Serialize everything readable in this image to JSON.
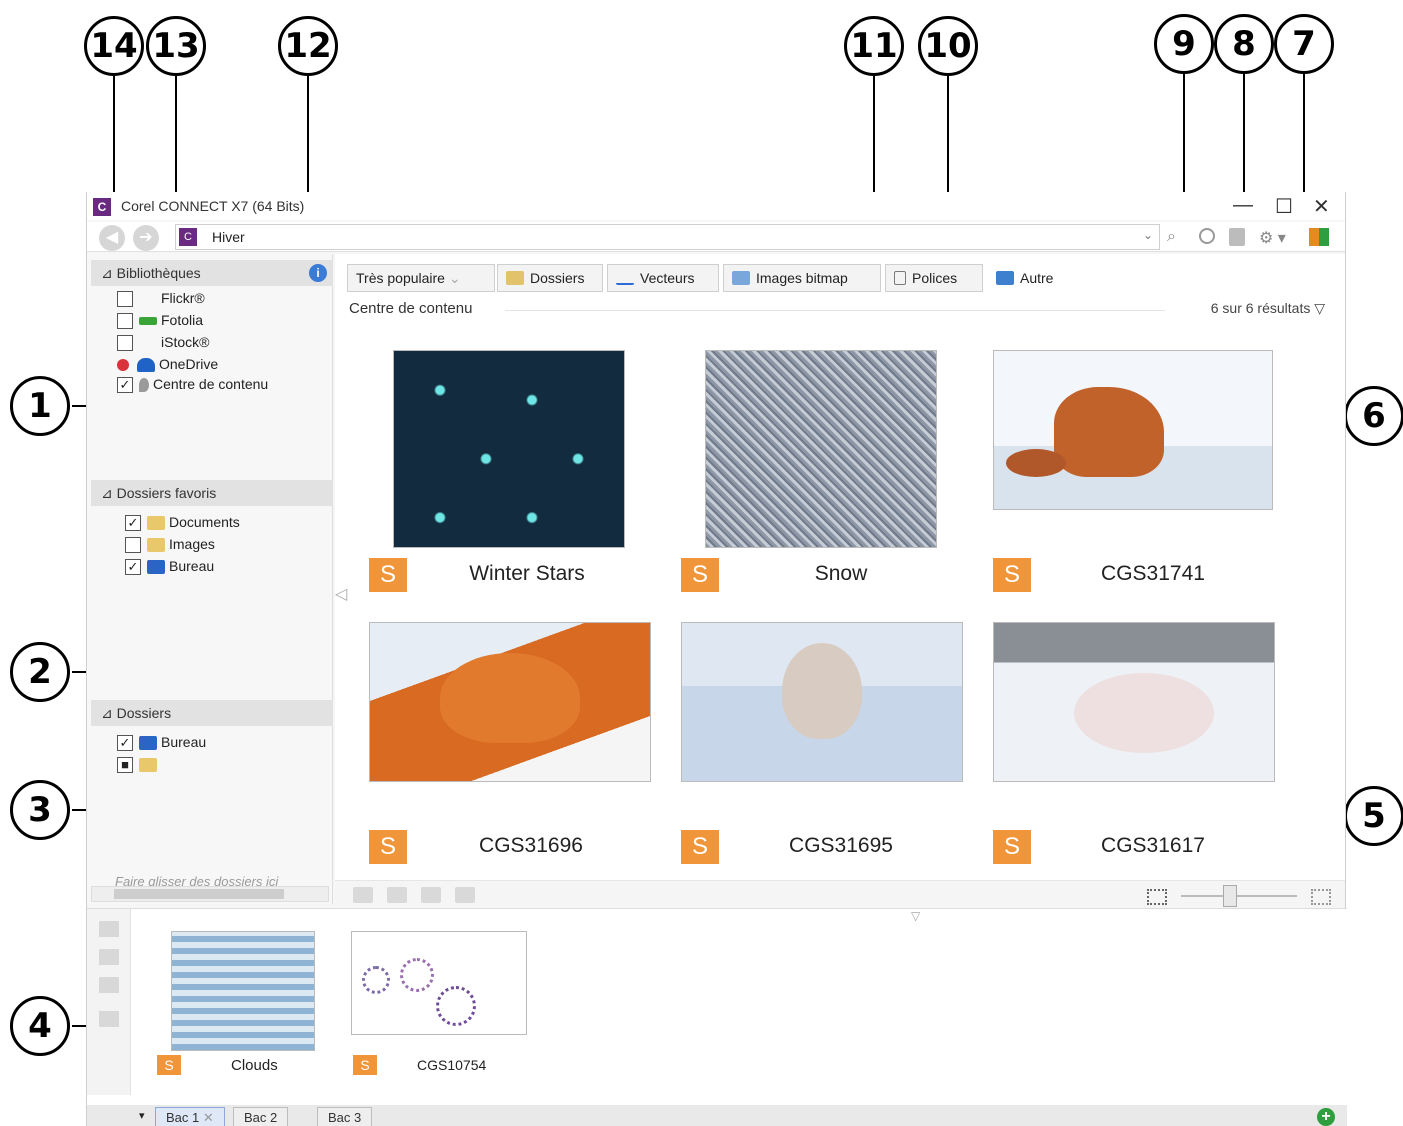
{
  "callouts": [
    "1",
    "2",
    "3",
    "4",
    "5",
    "6",
    "7",
    "8",
    "9",
    "10",
    "11",
    "12",
    "13",
    "14"
  ],
  "window": {
    "title": "Corel CONNECT X7 (64 Bits)",
    "minimize": "—",
    "maximize": "☐",
    "close": "✕"
  },
  "address": {
    "back": "◀",
    "forward": "➔",
    "value": "Hiver",
    "dropdown": "⌄"
  },
  "toolbar": {
    "icons": [
      "search-icon",
      "sync-icon",
      "clipboard-icon",
      "gear-icon",
      "layout-icon"
    ],
    "search": "⌕",
    "gear": "⚙ ▾"
  },
  "libraries": {
    "header": "Bibliothèques",
    "info": "i",
    "items": [
      {
        "label": "Flickr®",
        "checked": false
      },
      {
        "label": "Fotolia",
        "checked": false
      },
      {
        "label": "iStock®",
        "checked": false
      },
      {
        "label": "OneDrive",
        "checked": false
      },
      {
        "label": "Centre de contenu",
        "checked": true
      }
    ]
  },
  "favorites": {
    "header": "Dossiers favoris",
    "items": [
      {
        "label": "Documents",
        "checked": true
      },
      {
        "label": "Images",
        "checked": false
      },
      {
        "label": "Bureau",
        "checked": true
      }
    ],
    "hint": "Faire glisser des dossiers ici"
  },
  "folders": {
    "header": "Dossiers",
    "items": [
      {
        "label": "Bureau",
        "checked": true
      },
      {
        "label": "",
        "checked": true
      }
    ]
  },
  "filters": [
    "Très populaire",
    "Dossiers",
    "Vecteurs",
    "Images bitmap",
    "Polices",
    "Autre"
  ],
  "content": {
    "title": "Centre de contenu",
    "results": "6 sur 6 résultats ▽",
    "badge": "S",
    "items": [
      {
        "caption": "Winter Stars"
      },
      {
        "caption": "Snow"
      },
      {
        "caption": "CGS31741"
      },
      {
        "caption": "CGS31696"
      },
      {
        "caption": "CGS31695"
      },
      {
        "caption": "CGS31617"
      }
    ]
  },
  "tray": {
    "items": [
      {
        "caption": "Clouds"
      },
      {
        "caption": "CGS10754"
      }
    ],
    "tabs": [
      "Bac 1",
      "Bac 2",
      "Bac 3"
    ],
    "add": "+"
  }
}
